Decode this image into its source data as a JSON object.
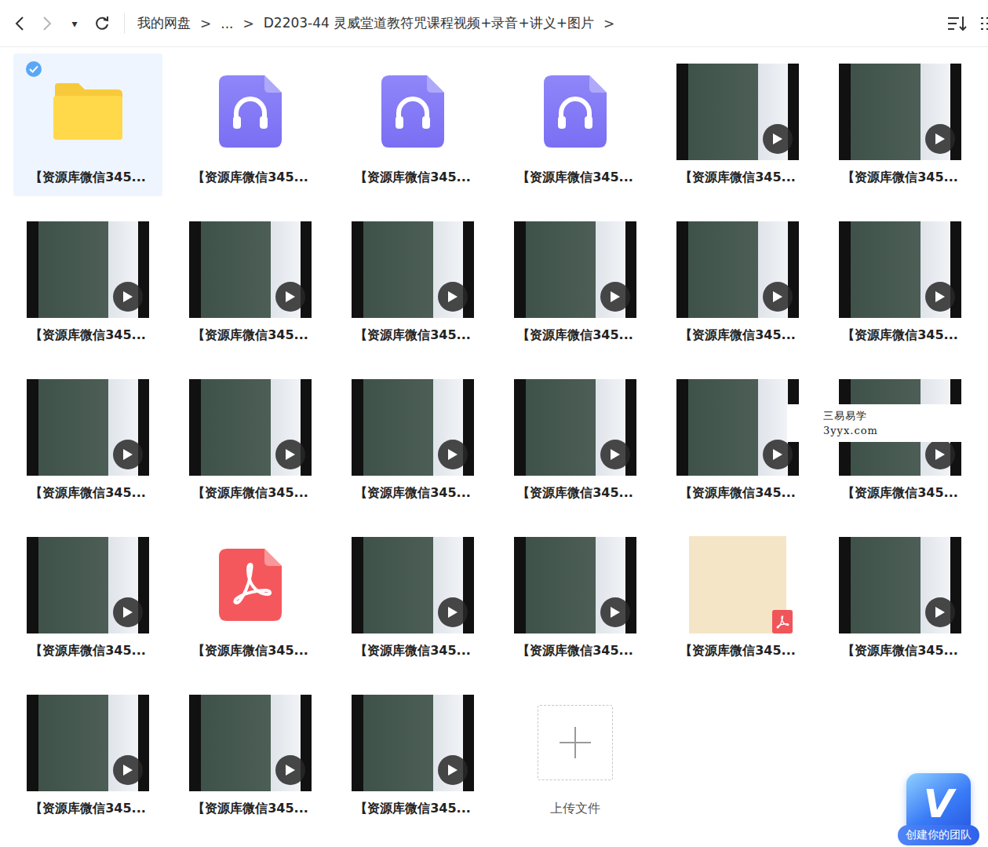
{
  "toolbar": {
    "dropdown": "▾",
    "breadcrumb": [
      "我的网盘",
      "...",
      "D2203-44 灵威堂道教符咒课程视频+录音+讲义+图片"
    ],
    "separator": ">"
  },
  "files": [
    {
      "name": "【资源库微信345...",
      "kind": "folder",
      "selected": true
    },
    {
      "name": "【资源库微信345...",
      "kind": "audio",
      "selected": false
    },
    {
      "name": "【资源库微信345...",
      "kind": "audio",
      "selected": false
    },
    {
      "name": "【资源库微信345...",
      "kind": "audio",
      "selected": false
    },
    {
      "name": "【资源库微信345...",
      "kind": "video",
      "selected": false
    },
    {
      "name": "【资源库微信345...",
      "kind": "video",
      "selected": false
    },
    {
      "name": "【资源库微信345...",
      "kind": "video",
      "selected": false
    },
    {
      "name": "【资源库微信345...",
      "kind": "video",
      "selected": false
    },
    {
      "name": "【资源库微信345...",
      "kind": "video",
      "selected": false
    },
    {
      "name": "【资源库微信345...",
      "kind": "video",
      "selected": false
    },
    {
      "name": "【资源库微信345...",
      "kind": "video",
      "selected": false
    },
    {
      "name": "【资源库微信345...",
      "kind": "video",
      "selected": false
    },
    {
      "name": "【资源库微信345...",
      "kind": "video",
      "selected": false
    },
    {
      "name": "【资源库微信345...",
      "kind": "video",
      "selected": false
    },
    {
      "name": "【资源库微信345...",
      "kind": "video",
      "selected": false
    },
    {
      "name": "【资源库微信345...",
      "kind": "video",
      "selected": false
    },
    {
      "name": "【资源库微信345...",
      "kind": "video",
      "selected": false
    },
    {
      "name": "【资源库微信345...",
      "kind": "video",
      "selected": false
    },
    {
      "name": "【资源库微信345...",
      "kind": "video",
      "selected": false
    },
    {
      "name": "【资源库微信345...",
      "kind": "pdf",
      "selected": false
    },
    {
      "name": "【资源库微信345...",
      "kind": "video",
      "selected": false
    },
    {
      "name": "【资源库微信345...",
      "kind": "video",
      "selected": false
    },
    {
      "name": "【资源库微信345...",
      "kind": "pdf-thumb",
      "selected": false
    },
    {
      "name": "【资源库微信345...",
      "kind": "video",
      "selected": false
    },
    {
      "name": "【资源库微信345...",
      "kind": "video",
      "selected": false
    },
    {
      "name": "【资源库微信345...",
      "kind": "video",
      "selected": false
    },
    {
      "name": "【资源库微信345...",
      "kind": "video",
      "selected": false
    }
  ],
  "upload": {
    "label": "上传文件"
  },
  "watermark": {
    "lines": [
      "三易易学",
      "3yyx.com"
    ],
    "over_index": 17
  },
  "team_badge": {
    "logo": "V",
    "label": "创建你的团队"
  }
}
